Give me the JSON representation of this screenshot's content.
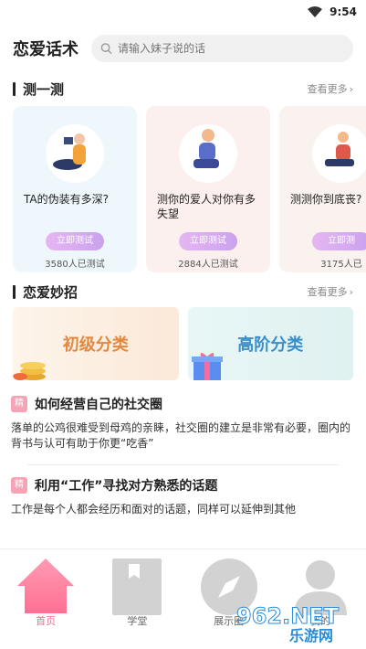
{
  "status_bar": {
    "time": "9:54"
  },
  "header": {
    "app_title": "恋爱话术",
    "search_placeholder": "请输入妹子说的话"
  },
  "quiz_section": {
    "title": "测一测",
    "more": "查看更多",
    "cards": [
      {
        "title": "TA的伪装有多深?",
        "button": "立即测试",
        "count": "3580人已测试"
      },
      {
        "title": "测你的爱人对你有多失望",
        "button": "立即测试",
        "count": "2884人已测试"
      },
      {
        "title": "测测你到底丧?",
        "button": "立即测",
        "count": "3175人已"
      }
    ]
  },
  "tips_section": {
    "title": "恋爱妙招",
    "more": "查看更多",
    "categories": [
      {
        "label": "初级分类"
      },
      {
        "label": "高阶分类"
      }
    ]
  },
  "articles": [
    {
      "tag": "精",
      "title": "如何经营自己的社交圈",
      "body": "落单的公鸡很难受到母鸡的亲睐，社交圈的建立是非常有必要，圈内的背书与认可有助于你更“吃香”"
    },
    {
      "tag": "精",
      "title": "利用“工作”寻找对方熟悉的话题",
      "body": "工作是每个人都会经历和面对的话题，同样可以延伸到其他"
    }
  ],
  "tabbar": {
    "items": [
      {
        "label": "首页",
        "icon": "home-icon"
      },
      {
        "label": "学堂",
        "icon": "book-icon"
      },
      {
        "label": "展示圈",
        "icon": "compass-icon"
      },
      {
        "label": "我的",
        "icon": "user-icon"
      }
    ]
  },
  "watermark": {
    "text": "962.NET",
    "sub": "乐游网"
  },
  "colors": {
    "accent": "#f06d8f",
    "button_gradient": "#d2a6f0",
    "basic": "#e2893f",
    "advanced": "#3a8fc9"
  }
}
